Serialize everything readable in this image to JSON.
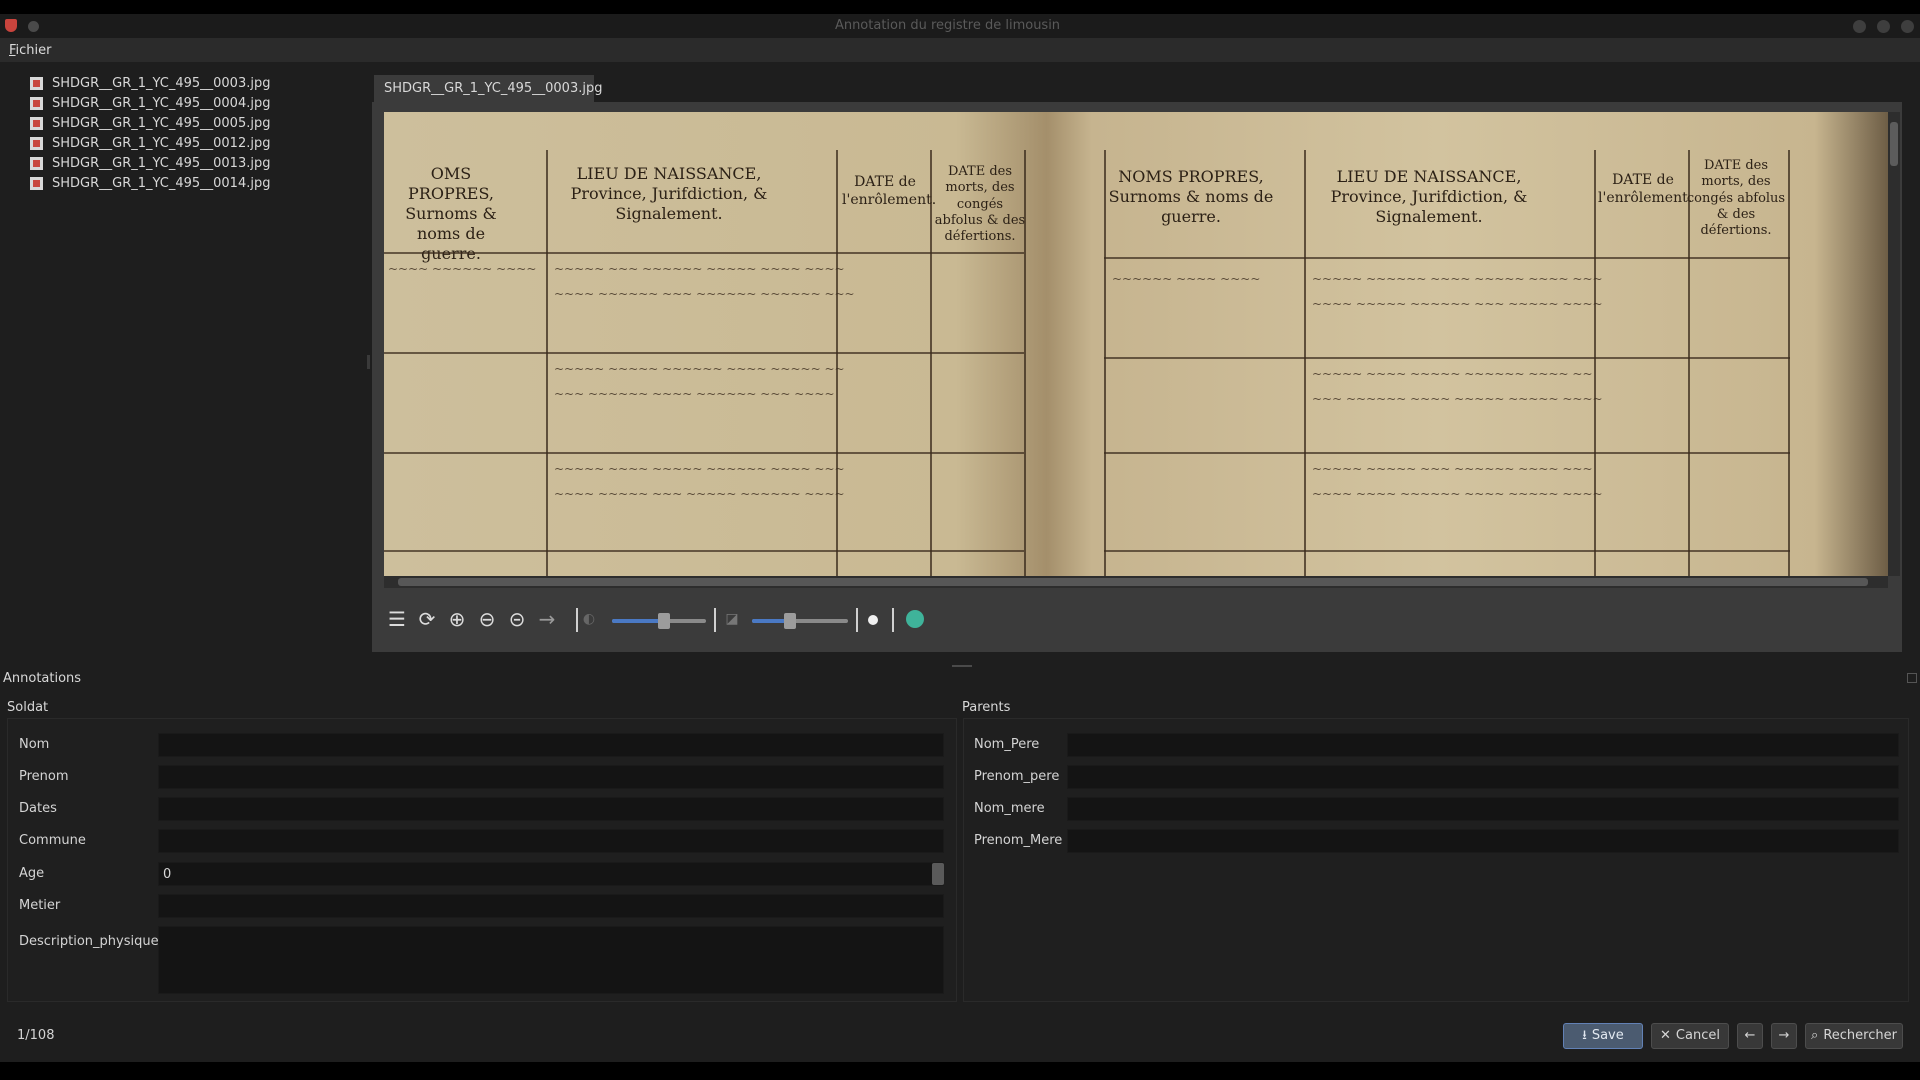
{
  "window": {
    "title": "Annotation du registre de limousin"
  },
  "menu": {
    "file": "Fichier"
  },
  "files": [
    "SHDGR__GR_1_YC_495__0003.jpg",
    "SHDGR__GR_1_YC_495__0004.jpg",
    "SHDGR__GR_1_YC_495__0005.jpg",
    "SHDGR__GR_1_YC_495__0012.jpg",
    "SHDGR__GR_1_YC_495__0013.jpg",
    "SHDGR__GR_1_YC_495__0014.jpg"
  ],
  "viewer": {
    "tab": "SHDGR__GR_1_YC_495__0003.jpg",
    "document": {
      "left_headers": [
        "OMS PROPRES, Surnoms & noms de guerre.",
        "LIEU DE NAISSANCE, Province, Jurifdiction, & Signalement.",
        "DATE de l'enrôlement.",
        "DATE des morts, des congés abfolus & des défertions."
      ],
      "right_headers": [
        "NOMS PROPRES, Surnoms & noms de guerre.",
        "LIEU DE NAISSANCE, Province, Jurifdiction, & Signalement.",
        "DATE de l'enrôlement.",
        "DATE des morts, des congés abfolus & des défertions."
      ]
    },
    "toolbar": {
      "brightness": 0.55,
      "contrast": 0.4
    }
  },
  "annotations": {
    "title": "Annotations",
    "soldat": {
      "title": "Soldat",
      "fields": {
        "nom": {
          "label": "Nom",
          "value": ""
        },
        "prenom": {
          "label": "Prenom",
          "value": ""
        },
        "dates": {
          "label": "Dates",
          "value": ""
        },
        "commune": {
          "label": "Commune",
          "value": ""
        },
        "age": {
          "label": "Age",
          "value": "0"
        },
        "metier": {
          "label": "Metier",
          "value": ""
        },
        "description": {
          "label": "Description_physique",
          "value": ""
        }
      }
    },
    "parents": {
      "title": "Parents",
      "fields": {
        "nom_pere": {
          "label": "Nom_Pere",
          "value": ""
        },
        "prenom_pere": {
          "label": "Prenom_pere",
          "value": ""
        },
        "nom_mere": {
          "label": "Nom_mere",
          "value": ""
        },
        "prenom_mere": {
          "label": "Prenom_Mere",
          "value": ""
        }
      }
    }
  },
  "footer": {
    "page_count": "1/108",
    "save": "Save",
    "cancel": "Cancel",
    "search": "Rechercher"
  },
  "colors": {
    "accent": "#4a79c4",
    "save_border": "#6281b5",
    "teal": "#3fb39a"
  }
}
